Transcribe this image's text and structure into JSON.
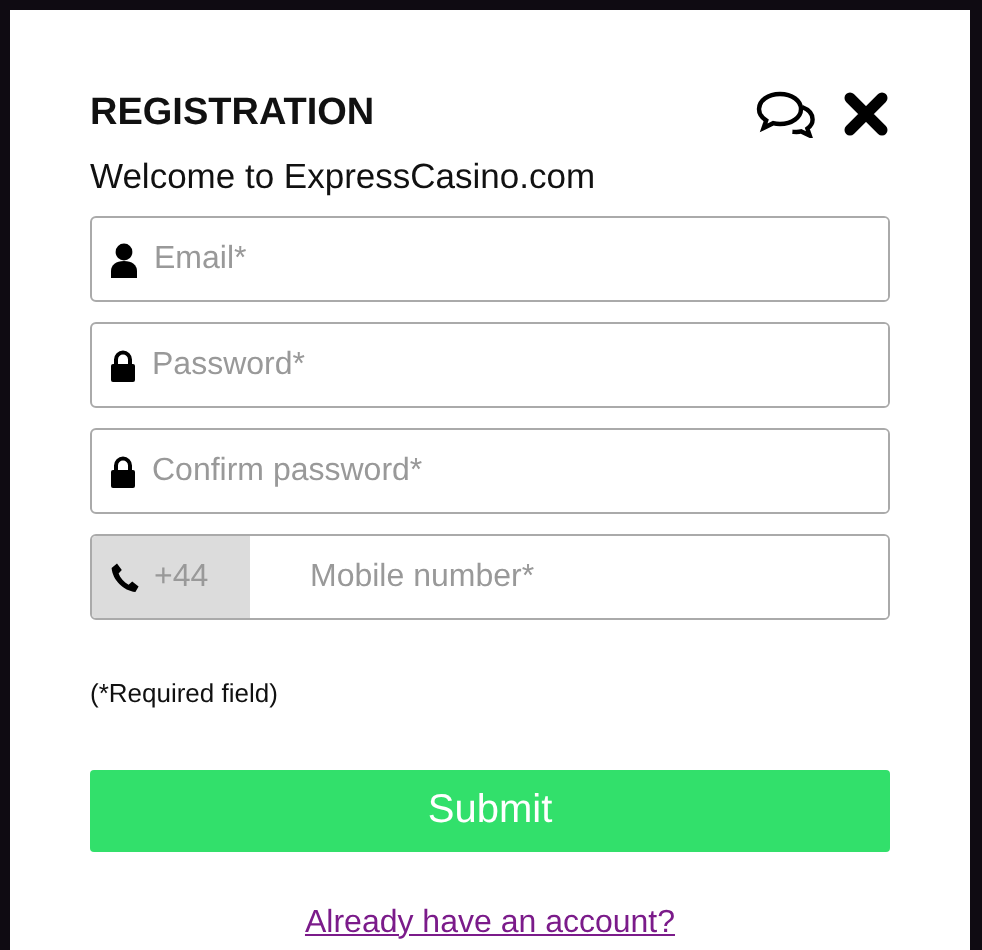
{
  "dialog": {
    "title": "REGISTRATION",
    "subtitle": "Welcome to ExpressCasino.com"
  },
  "fields": [
    {
      "kind": "email",
      "placeholder": "Email*"
    },
    {
      "kind": "password",
      "placeholder": "Password*"
    },
    {
      "kind": "password",
      "placeholder": "Confirm password*"
    },
    {
      "kind": "phone",
      "prefix": "+44",
      "placeholder": "Mobile number*"
    }
  ],
  "note": "(*Required field)",
  "submit": "Submit",
  "login_link": "Already have an account?"
}
